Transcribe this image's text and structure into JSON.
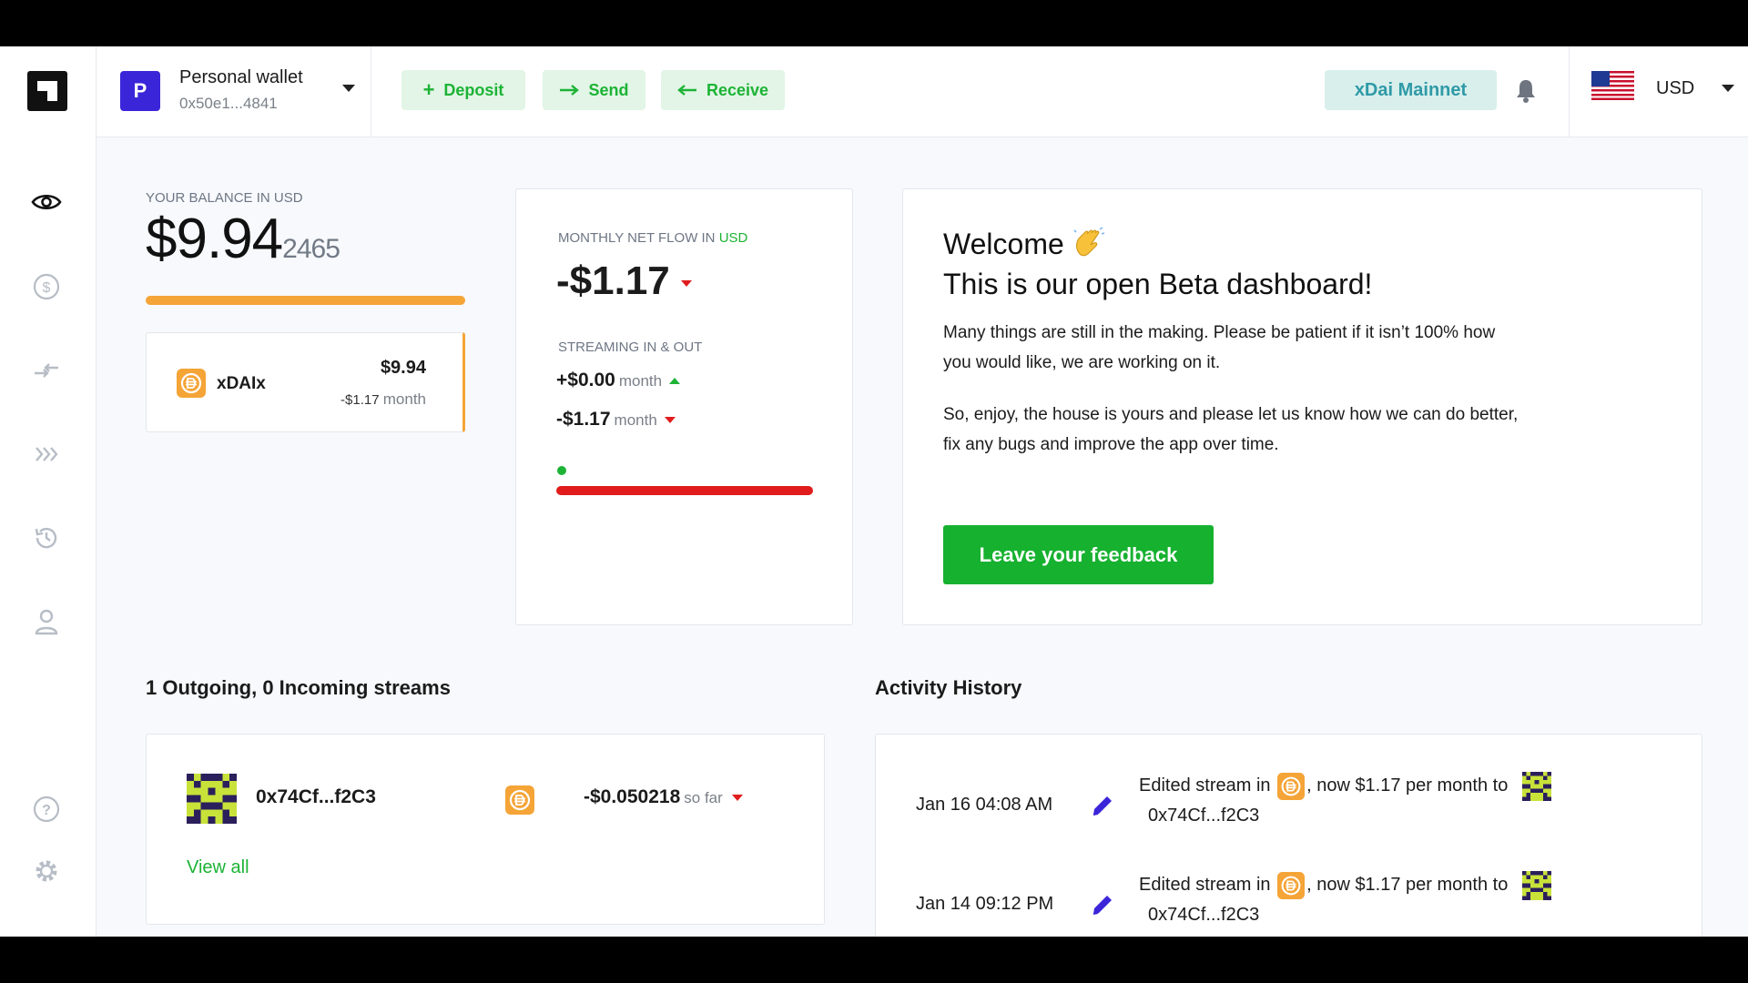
{
  "topbar": {
    "wallet": {
      "avatar_letter": "P",
      "name": "Personal wallet",
      "address": "0x50e1...4841"
    },
    "actions": {
      "deposit": "Deposit",
      "send": "Send",
      "receive": "Receive"
    },
    "network": "xDai Mainnet",
    "currency": "USD"
  },
  "sidebar": {
    "items": [
      "eye-icon",
      "dollar-icon",
      "swap-icon",
      "stream-icon",
      "history-icon",
      "user-icon",
      "help-icon",
      "settings-icon"
    ]
  },
  "balance": {
    "label": "YOUR BALANCE IN USD",
    "main": "$9.94",
    "fraction": "2465",
    "token": {
      "name": "xDAIx",
      "value": "$9.94",
      "flow": "-$1.17",
      "unit": "month"
    }
  },
  "net_flow": {
    "label": "MONTHLY NET FLOW IN",
    "currency": "USD",
    "value": "-$1.17",
    "streaming_label": "STREAMING IN & OUT",
    "in_value": "+$0.00",
    "out_value": "-$1.17",
    "unit": "month"
  },
  "welcome": {
    "title_line1": "Welcome",
    "title_line2": "This is our open Beta dashboard!",
    "para1": "Many things are still in the making. Please be patient if it isn’t 100% how you would like, we are working on it.",
    "para2": "So, enjoy, the house is yours and please let us know how we can do better, fix any bugs and improve the app over time.",
    "button": "Leave your feedback"
  },
  "streams": {
    "title": "1 Outgoing, 0 Incoming streams",
    "items": [
      {
        "address": "0x74Cf...f2C3",
        "amount": "-$0.050218",
        "unit": "so far"
      }
    ],
    "view_all": "View all"
  },
  "activity": {
    "title": "Activity History",
    "items": [
      {
        "time": "Jan 16 04:08 AM",
        "prefix": "Edited stream in",
        "middle": ", now $1.17 per month to",
        "address": "0x74Cf...f2C3"
      },
      {
        "time": "Jan 14 09:12 PM",
        "prefix": "Edited stream in",
        "middle": ", now $1.17 per month to",
        "address": "0x74Cf...f2C3"
      }
    ]
  },
  "colors": {
    "accent_green": "#1db335",
    "orange": "#f5a437",
    "red": "#e01c1c",
    "wallet_purple": "#3b25d9"
  }
}
